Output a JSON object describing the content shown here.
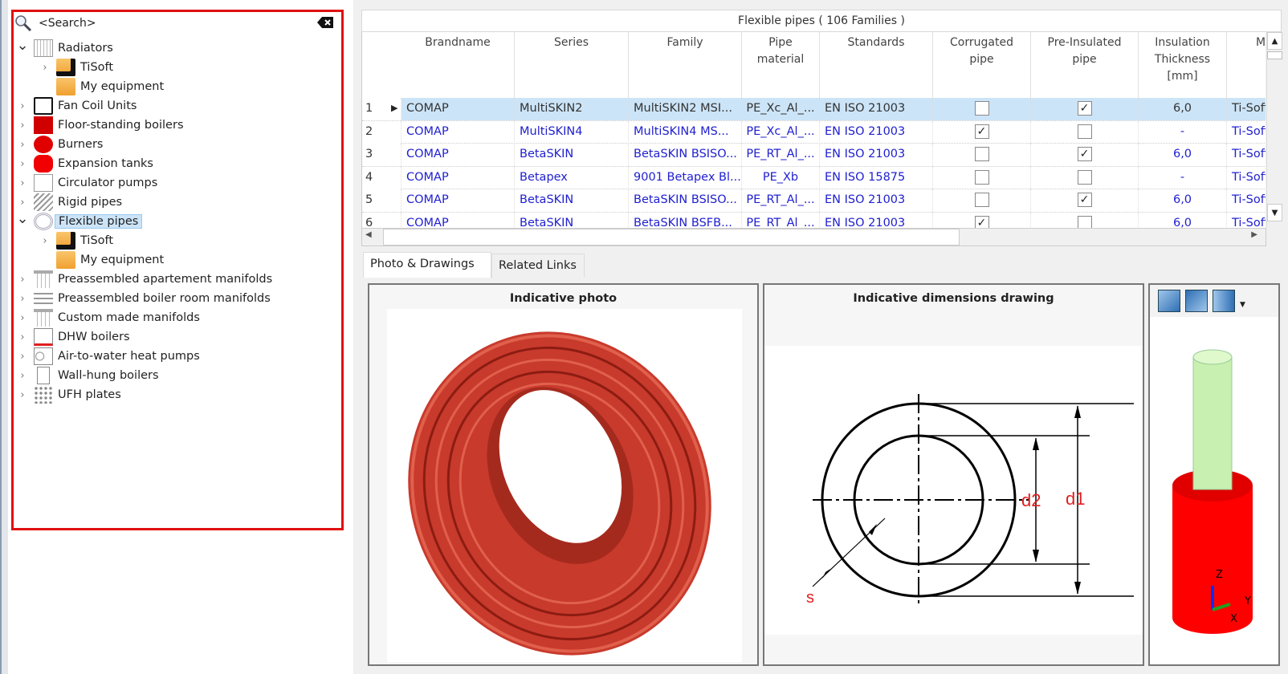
{
  "tree": {
    "search_placeholder": "<Search>",
    "items": [
      {
        "label": "Radiators",
        "expanded": true,
        "icon": "radiator-icon"
      },
      {
        "label": "TiSoft",
        "child": true,
        "icon": "locked-folder-icon"
      },
      {
        "label": "My equipment",
        "child": true,
        "icon": "folder-icon"
      },
      {
        "label": "Fan Coil Units",
        "icon": "fan-coil-icon"
      },
      {
        "label": "Floor-standing boilers",
        "icon": "boiler-icon"
      },
      {
        "label": "Burners",
        "icon": "burner-icon"
      },
      {
        "label": "Expansion tanks",
        "icon": "expansion-tank-icon"
      },
      {
        "label": "Circulator pumps",
        "icon": "pump-icon"
      },
      {
        "label": "Rigid pipes",
        "icon": "rigid-pipe-icon"
      },
      {
        "label": "Flexible pipes",
        "expanded": true,
        "selected": true,
        "icon": "flexible-pipe-icon"
      },
      {
        "label": "TiSoft",
        "child": true,
        "icon": "locked-folder-icon"
      },
      {
        "label": "My equipment",
        "child": true,
        "icon": "folder-icon"
      },
      {
        "label": "Preassembled apartement manifolds",
        "icon": "manifold-icon"
      },
      {
        "label": "Preassembled boiler room manifolds",
        "icon": "boiler-manifold-icon"
      },
      {
        "label": "Custom made manifolds",
        "icon": "manifold-icon"
      },
      {
        "label": "DHW boilers",
        "icon": "dhw-boiler-icon"
      },
      {
        "label": "Air-to-water heat pumps",
        "icon": "heat-pump-icon"
      },
      {
        "label": "Wall-hung boilers",
        "icon": "wall-boiler-icon"
      },
      {
        "label": "UFH plates",
        "icon": "ufh-plate-icon"
      }
    ]
  },
  "grid": {
    "title": "Flexible pipes ( 106 Families )",
    "columns": [
      "Brandname",
      "Series",
      "Family",
      "Pipe\nmaterial",
      "Standards",
      "Corrugated\npipe",
      "Pre-Insulated\npipe",
      "Insulation\nThickness\n[mm]",
      "M"
    ],
    "rows": [
      {
        "n": "1",
        "brand": "COMAP",
        "series": "MultiSKIN2",
        "family": "MultiSKIN2 MSI...",
        "material": "PE_Xc_Al_...",
        "standards": "EN  ISO  21003",
        "corrugated": false,
        "preinsulated": true,
        "thickness": "6,0",
        "m": "Ti-Soft"
      },
      {
        "n": "2",
        "brand": "COMAP",
        "series": "MultiSKIN4",
        "family": "MultiSKIN4 MS...",
        "material": "PE_Xc_Al_...",
        "standards": "EN  ISO  21003",
        "corrugated": true,
        "preinsulated": false,
        "thickness": "-",
        "m": "Ti-Soft"
      },
      {
        "n": "3",
        "brand": "COMAP",
        "series": "BetaSKIN",
        "family": "BetaSKIN BSISO...",
        "material": "PE_RT_Al_...",
        "standards": "EN ISO  21003",
        "corrugated": false,
        "preinsulated": true,
        "thickness": "6,0",
        "m": "Ti-Soft"
      },
      {
        "n": "4",
        "brand": "COMAP",
        "series": "Betapex",
        "family": "9001 Betapex Bl...",
        "material": "PE_Xb",
        "standards": "EN ISO 15875",
        "corrugated": false,
        "preinsulated": false,
        "thickness": "-",
        "m": "Ti-Soft"
      },
      {
        "n": "5",
        "brand": "COMAP",
        "series": "BetaSKIN",
        "family": "BetaSKIN BSISO...",
        "material": "PE_RT_Al_...",
        "standards": "EN ISO  21003",
        "corrugated": false,
        "preinsulated": true,
        "thickness": "6,0",
        "m": "Ti-Soft"
      },
      {
        "n": "6",
        "brand": "COMAP",
        "series": "BetaSKIN",
        "family": "BetaSKIN BSFB...",
        "material": "PE_RT_Al_...",
        "standards": "EN ISO  21003",
        "corrugated": true,
        "preinsulated": false,
        "thickness": "6,0",
        "m": "Ti-Soft"
      }
    ]
  },
  "tabs": [
    {
      "label": "Photo & Drawings",
      "active": true
    },
    {
      "label": "Related Links"
    }
  ],
  "panels": {
    "photo_title": "Indicative photo",
    "drawing_title": "Indicative dimensions drawing",
    "drawing_labels": {
      "d1": "d1",
      "d2": "d2",
      "s": "s"
    },
    "axis_labels": {
      "z": "Z",
      "y": "Y",
      "x": "X"
    }
  },
  "colors": {
    "selection": "#cce4f7",
    "highlight_box": "#e01010",
    "link_text": "#2020d0",
    "pipe_insulation": "#ff0000",
    "pipe_core": "#c8f0b0"
  }
}
